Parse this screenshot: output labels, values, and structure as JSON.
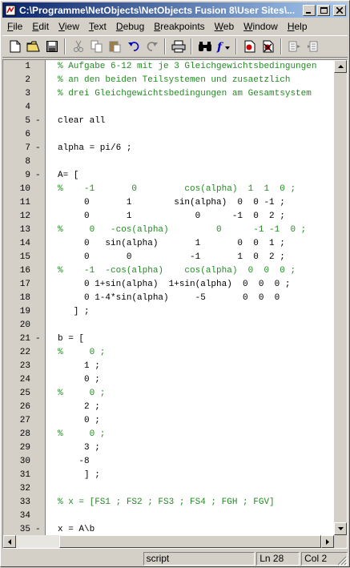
{
  "window": {
    "title": "C:\\Programme\\NetObjects\\NetObjects Fusion 8\\User Sites\\...",
    "minimize": "_",
    "maximize": "□",
    "close": "✕"
  },
  "menu": [
    {
      "label": "File",
      "key": "F",
      "rest": "ile"
    },
    {
      "label": "Edit",
      "key": "E",
      "rest": "dit"
    },
    {
      "label": "View",
      "key": "V",
      "rest": "iew"
    },
    {
      "label": "Text",
      "key": "T",
      "rest": "ext"
    },
    {
      "label": "Debug",
      "key": "D",
      "rest": "ebug"
    },
    {
      "label": "Breakpoints",
      "key": "B",
      "rest": "reakpoints"
    },
    {
      "label": "Web",
      "key": "W",
      "rest": "eb"
    },
    {
      "label": "Window",
      "key": "W",
      "rest": "indow"
    },
    {
      "label": "Help",
      "key": "H",
      "rest": "elp"
    }
  ],
  "toolbar": [
    "new-file-icon",
    "open-folder-icon",
    "save-icon",
    "cut-icon",
    "copy-icon",
    "paste-icon",
    "undo-icon",
    "redo-icon",
    "print-icon",
    "find-icon",
    "function-icon",
    "set-breakpoint-icon",
    "clear-breakpoint-icon",
    "step-icon",
    "step-in-icon"
  ],
  "lines": [
    {
      "n": "1",
      "dash": "",
      "text": "% Aufgabe 6-12 mit je 3 Gleichgewichtsbedingungen",
      "comment": true
    },
    {
      "n": "2",
      "dash": "",
      "text": "% an den beiden Teilsystemen und zusaetzlich",
      "comment": true
    },
    {
      "n": "3",
      "dash": "",
      "text": "% drei Gleichgewichtsbedingungen am Gesamtsystem",
      "comment": true
    },
    {
      "n": "4",
      "dash": "",
      "text": "",
      "comment": false
    },
    {
      "n": "5",
      "dash": "-",
      "text": "clear all",
      "comment": false
    },
    {
      "n": "6",
      "dash": "",
      "text": "",
      "comment": false
    },
    {
      "n": "7",
      "dash": "-",
      "text": "alpha = pi/6 ;",
      "comment": false
    },
    {
      "n": "8",
      "dash": "",
      "text": "",
      "comment": false
    },
    {
      "n": "9",
      "dash": "-",
      "text": "A= [",
      "comment": false
    },
    {
      "n": "10",
      "dash": "",
      "text": "%    -1       0         cos(alpha)  1  1  0 ;",
      "comment": true
    },
    {
      "n": "11",
      "dash": "",
      "text": "     0       1        sin(alpha)  0  0 -1 ;",
      "comment": false
    },
    {
      "n": "12",
      "dash": "",
      "text": "     0       1            0      -1  0  2 ;",
      "comment": false
    },
    {
      "n": "13",
      "dash": "",
      "text": "%     0   -cos(alpha)         0      -1 -1  0 ;",
      "comment": true
    },
    {
      "n": "14",
      "dash": "",
      "text": "     0   sin(alpha)       1       0  0  1 ;",
      "comment": false
    },
    {
      "n": "15",
      "dash": "",
      "text": "     0       0           -1       1  0  2 ;",
      "comment": false
    },
    {
      "n": "16",
      "dash": "",
      "text": "%    -1  -cos(alpha)    cos(alpha)  0  0  0 ;",
      "comment": true
    },
    {
      "n": "17",
      "dash": "",
      "text": "     0 1+sin(alpha)  1+sin(alpha)  0  0  0 ;",
      "comment": false
    },
    {
      "n": "18",
      "dash": "",
      "text": "     0 1-4*sin(alpha)     -5       0  0  0",
      "comment": false
    },
    {
      "n": "19",
      "dash": "",
      "text": "   ] ;",
      "comment": false
    },
    {
      "n": "20",
      "dash": "",
      "text": "",
      "comment": false
    },
    {
      "n": "21",
      "dash": "-",
      "text": "b = [",
      "comment": false
    },
    {
      "n": "22",
      "dash": "",
      "text": "%     0 ;",
      "comment": true
    },
    {
      "n": "23",
      "dash": "",
      "text": "     1 ;",
      "comment": false
    },
    {
      "n": "24",
      "dash": "",
      "text": "     0 ;",
      "comment": false
    },
    {
      "n": "25",
      "dash": "",
      "text": "%     0 ;",
      "comment": true
    },
    {
      "n": "26",
      "dash": "",
      "text": "     2 ;",
      "comment": false
    },
    {
      "n": "27",
      "dash": "",
      "text": "     0 ;",
      "comment": false
    },
    {
      "n": "28",
      "dash": "",
      "text": "%     0 ;",
      "comment": true
    },
    {
      "n": "29",
      "dash": "",
      "text": "     3 ;",
      "comment": false
    },
    {
      "n": "30",
      "dash": "",
      "text": "    -8",
      "comment": false
    },
    {
      "n": "31",
      "dash": "",
      "text": "     ] ;",
      "comment": false
    },
    {
      "n": "32",
      "dash": "",
      "text": "",
      "comment": false
    },
    {
      "n": "33",
      "dash": "",
      "text": "% x = [FS1 ; FS2 ; FS3 ; FS4 ; FGH ; FGV]",
      "comment": true
    },
    {
      "n": "34",
      "dash": "",
      "text": "",
      "comment": false
    },
    {
      "n": "35",
      "dash": "-",
      "text": "x = A\\b",
      "comment": false
    }
  ],
  "status": {
    "mode": "script",
    "line": "Ln 28",
    "col": "Col 2"
  },
  "colors": {
    "comment": "#228b22",
    "titlebar_start": "#0a246a",
    "titlebar_end": "#a6caf0"
  }
}
